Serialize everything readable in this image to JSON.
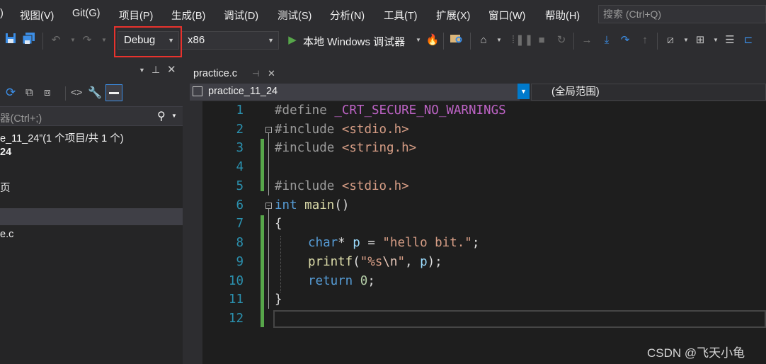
{
  "menu": {
    "items": [
      "视图(V)",
      "Git(G)",
      "项目(P)",
      "生成(B)",
      "调试(D)",
      "测试(S)",
      "分析(N)",
      "工具(T)",
      "扩展(X)",
      "窗口(W)",
      "帮助(H)"
    ],
    "search_placeholder": "搜索 (Ctrl+Q)"
  },
  "toolbar": {
    "config": "Debug",
    "platform": "x86",
    "run_label": "本地 Windows 调试器"
  },
  "solution_explorer": {
    "search_text": "器(Ctrl+;)",
    "lines": [
      "e_11_24”(1 个项目/共 1 个)",
      "24",
      "页",
      "e.c"
    ]
  },
  "editor": {
    "tab": "practice.c",
    "scope_left": "practice_11_24",
    "scope_right": "(全局范围)",
    "line_numbers": [
      "1",
      "2",
      "3",
      "4",
      "5",
      "6",
      "7",
      "8",
      "9",
      "10",
      "11",
      "12"
    ],
    "code": {
      "l1_pp": "#define",
      "l1_mac": "_CRT_SECURE_NO_WARNINGS",
      "l2_pp": "#include",
      "l2_inc": "<stdio.h>",
      "l3_pp": "#include",
      "l3_inc": "<string.h>",
      "l5_pp": "#include",
      "l5_inc": "<stdio.h>",
      "l6_kw": "int",
      "l6_fn": "main",
      "l6_rest": "()",
      "l7": "{",
      "l8_kw": "char",
      "l8_a": "* ",
      "l8_var": "p",
      "l8_b": " = ",
      "l8_str": "\"hello bit.\"",
      "l8_c": ";",
      "l9_fn": "printf",
      "l9_a": "(",
      "l9_str1": "\"%s",
      "l9_esc": "\\n",
      "l9_str2": "\"",
      "l9_b": ", ",
      "l9_var": "p",
      "l9_c": ");",
      "l10_kw": "return",
      "l10_num": "0",
      "l10_c": ";",
      "l11": "}"
    }
  },
  "watermark": "CSDN @飞天小龟",
  "colors": {
    "background": "#2d2d30",
    "editor": "#1e1e1e",
    "accent": "#007acc",
    "highlight_box": "#e8322d",
    "change_bar": "#57a64a"
  }
}
